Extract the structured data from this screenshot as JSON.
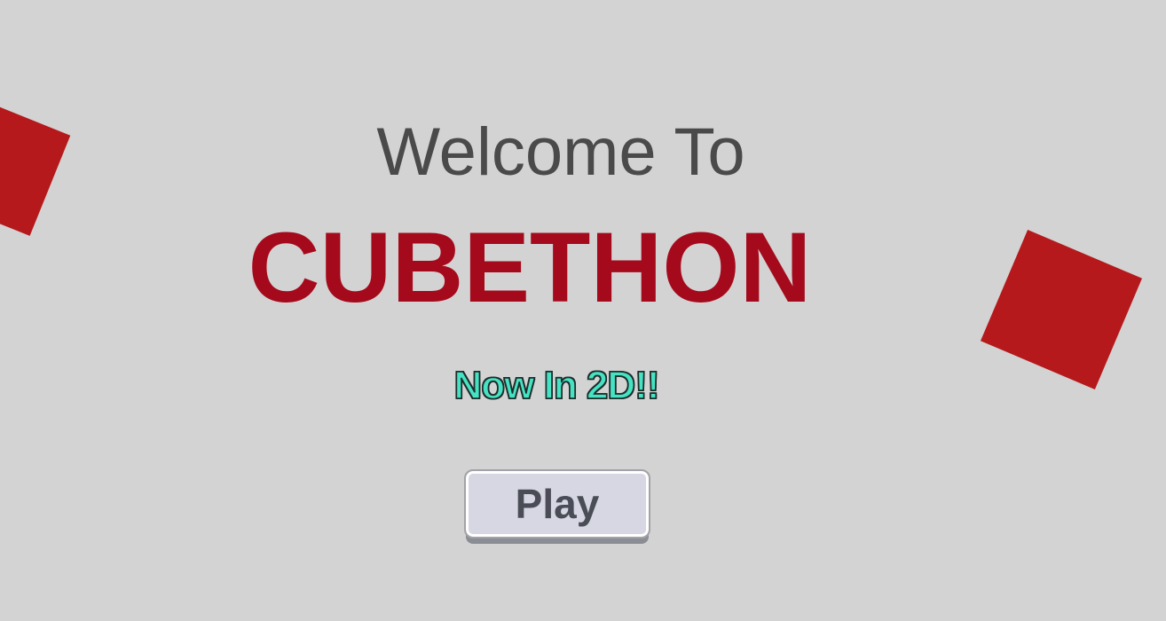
{
  "screen": {
    "welcome_text": "Welcome To",
    "game_title": "CUBETHON",
    "tagline": "Now In 2D!!",
    "play_label": "Play"
  },
  "decorations": {
    "cube_color": "#b5191b",
    "cubes": [
      {
        "name": "left-cube"
      },
      {
        "name": "right-cube"
      }
    ]
  },
  "colors": {
    "background": "#d3d3d3",
    "title": "#a50a1c",
    "welcome": "#4a4a4a",
    "tagline_fill": "#45e3c3",
    "tagline_outline": "#1d2d2a",
    "button_fill": "#d6d7e3",
    "button_text": "#4b4d56"
  }
}
